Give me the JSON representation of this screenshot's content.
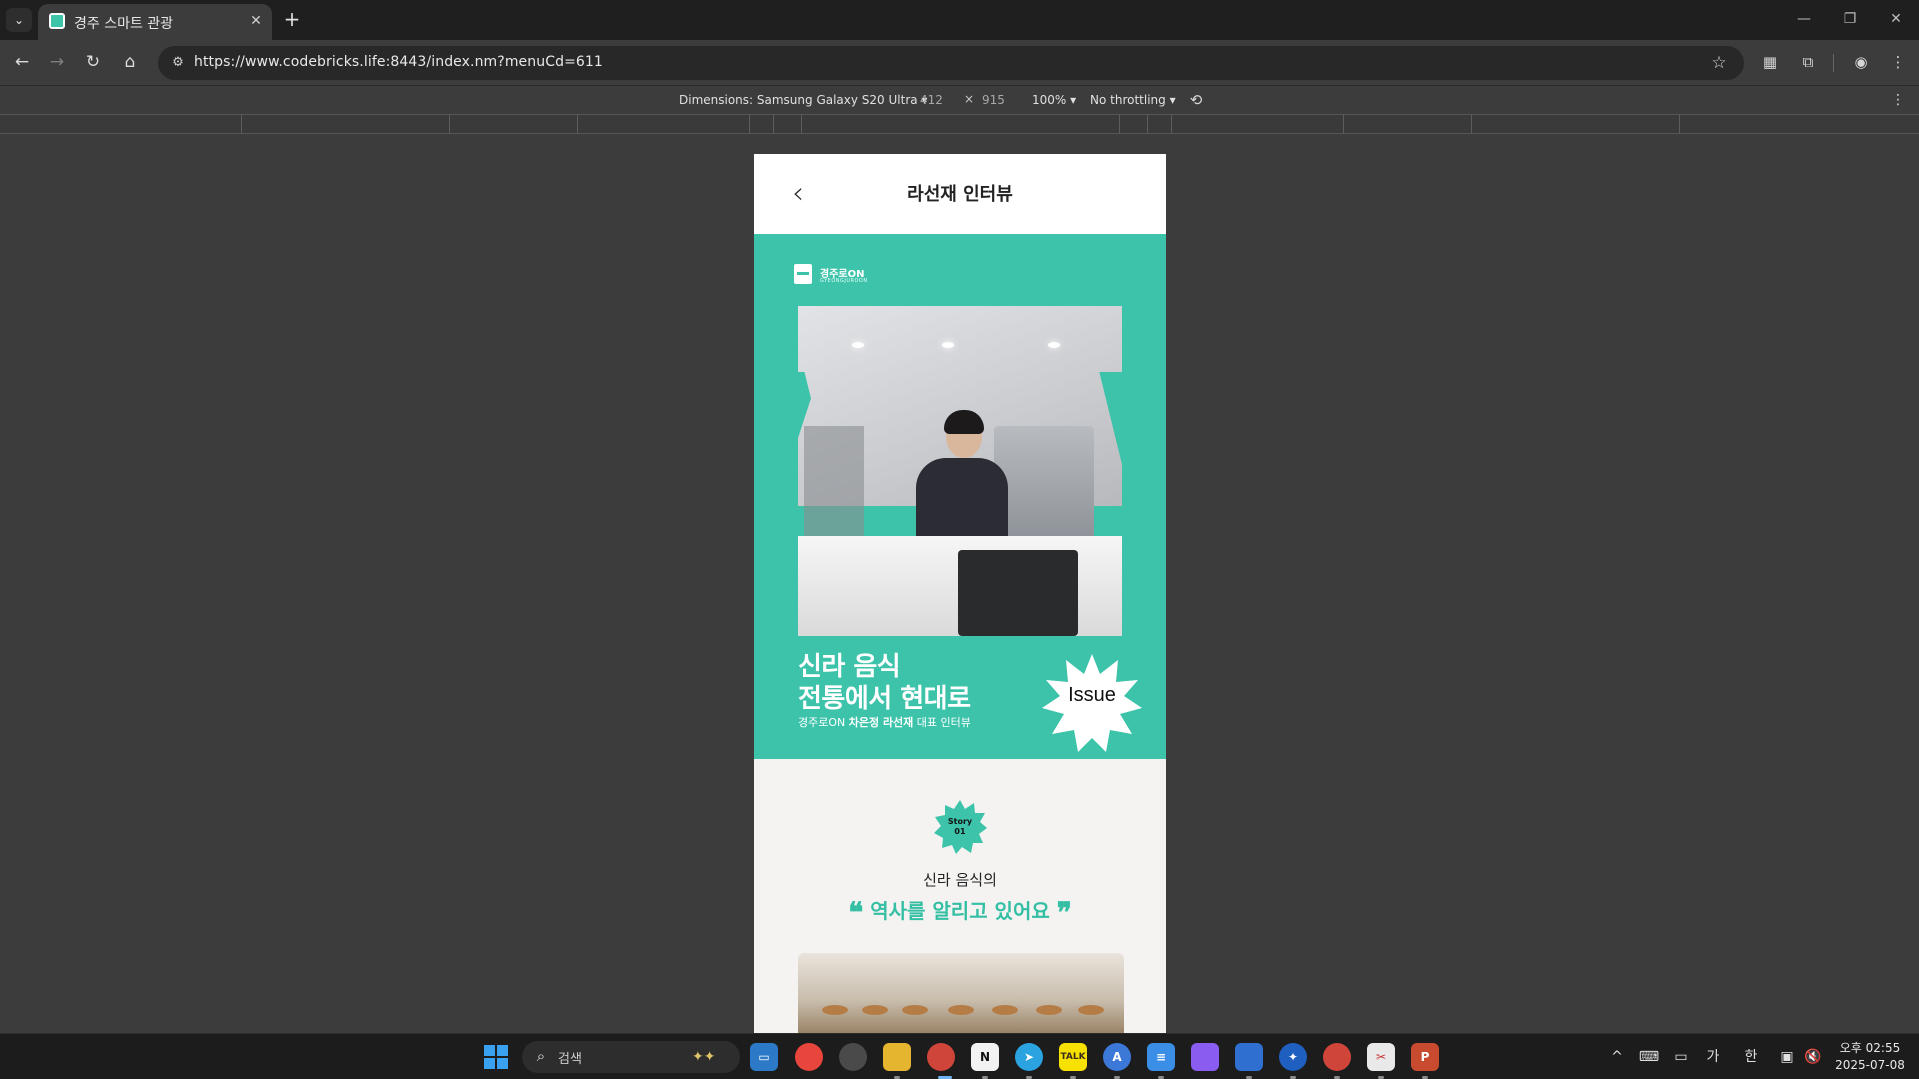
{
  "browser": {
    "tab_list_icon": "chevron-down-icon",
    "tab": {
      "title": "경주 스마트 관광",
      "close": "✕"
    },
    "new_tab": "+",
    "window": {
      "minimize": "—",
      "restore": "❐",
      "close": "✕"
    },
    "url": "https://www.codebricks.life:8443/index.nm?menuCd=611"
  },
  "devtools": {
    "dimensions_label": "Dimensions: Samsung Galaxy S20 Ultra ▾",
    "width": "412",
    "times": "×",
    "height": "915",
    "zoom": "100% ▾",
    "throttling": "No throttling ▾"
  },
  "mobile": {
    "header_title": "라선재 인터뷰",
    "back": "‹",
    "brand_name": "경주로ON",
    "brand_sub": "GYEONGJUROON",
    "hero_line1": "신라 음식",
    "hero_line2": "전통에서 현대로",
    "hero_sub_prefix": "경주로ON ",
    "hero_sub_bold": "차은정 라선재",
    "hero_sub_suffix": " 대표 인터뷰",
    "issue_badge": "Issue",
    "story_badge_line1": "Story",
    "story_badge_line2": "01",
    "story_line1": "신라 음식의",
    "quote_open": "❝",
    "story_line2": "역사를 알리고 있어요",
    "quote_close": "❞"
  },
  "taskbar": {
    "search_placeholder": "검색",
    "tray": {
      "chevron": "^",
      "ime_mode": "가",
      "ime_lang": "한"
    },
    "clock_time": "오후 02:55",
    "clock_date": "2025-07-08"
  },
  "colors": {
    "mint": "#3cc3aa",
    "accent_text": "#34bfa4"
  }
}
